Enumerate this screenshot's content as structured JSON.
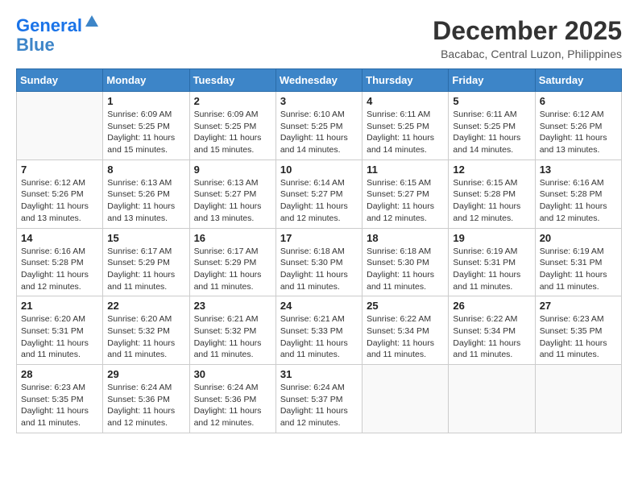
{
  "logo": {
    "line1": "General",
    "line2": "Blue"
  },
  "title": "December 2025",
  "location": "Bacabac, Central Luzon, Philippines",
  "weekdays": [
    "Sunday",
    "Monday",
    "Tuesday",
    "Wednesday",
    "Thursday",
    "Friday",
    "Saturday"
  ],
  "weeks": [
    [
      {
        "day": "",
        "sunrise": "",
        "sunset": "",
        "daylight": ""
      },
      {
        "day": "1",
        "sunrise": "Sunrise: 6:09 AM",
        "sunset": "Sunset: 5:25 PM",
        "daylight": "Daylight: 11 hours and 15 minutes."
      },
      {
        "day": "2",
        "sunrise": "Sunrise: 6:09 AM",
        "sunset": "Sunset: 5:25 PM",
        "daylight": "Daylight: 11 hours and 15 minutes."
      },
      {
        "day": "3",
        "sunrise": "Sunrise: 6:10 AM",
        "sunset": "Sunset: 5:25 PM",
        "daylight": "Daylight: 11 hours and 14 minutes."
      },
      {
        "day": "4",
        "sunrise": "Sunrise: 6:11 AM",
        "sunset": "Sunset: 5:25 PM",
        "daylight": "Daylight: 11 hours and 14 minutes."
      },
      {
        "day": "5",
        "sunrise": "Sunrise: 6:11 AM",
        "sunset": "Sunset: 5:25 PM",
        "daylight": "Daylight: 11 hours and 14 minutes."
      },
      {
        "day": "6",
        "sunrise": "Sunrise: 6:12 AM",
        "sunset": "Sunset: 5:26 PM",
        "daylight": "Daylight: 11 hours and 13 minutes."
      }
    ],
    [
      {
        "day": "7",
        "sunrise": "Sunrise: 6:12 AM",
        "sunset": "Sunset: 5:26 PM",
        "daylight": "Daylight: 11 hours and 13 minutes."
      },
      {
        "day": "8",
        "sunrise": "Sunrise: 6:13 AM",
        "sunset": "Sunset: 5:26 PM",
        "daylight": "Daylight: 11 hours and 13 minutes."
      },
      {
        "day": "9",
        "sunrise": "Sunrise: 6:13 AM",
        "sunset": "Sunset: 5:27 PM",
        "daylight": "Daylight: 11 hours and 13 minutes."
      },
      {
        "day": "10",
        "sunrise": "Sunrise: 6:14 AM",
        "sunset": "Sunset: 5:27 PM",
        "daylight": "Daylight: 11 hours and 12 minutes."
      },
      {
        "day": "11",
        "sunrise": "Sunrise: 6:15 AM",
        "sunset": "Sunset: 5:27 PM",
        "daylight": "Daylight: 11 hours and 12 minutes."
      },
      {
        "day": "12",
        "sunrise": "Sunrise: 6:15 AM",
        "sunset": "Sunset: 5:28 PM",
        "daylight": "Daylight: 11 hours and 12 minutes."
      },
      {
        "day": "13",
        "sunrise": "Sunrise: 6:16 AM",
        "sunset": "Sunset: 5:28 PM",
        "daylight": "Daylight: 11 hours and 12 minutes."
      }
    ],
    [
      {
        "day": "14",
        "sunrise": "Sunrise: 6:16 AM",
        "sunset": "Sunset: 5:28 PM",
        "daylight": "Daylight: 11 hours and 12 minutes."
      },
      {
        "day": "15",
        "sunrise": "Sunrise: 6:17 AM",
        "sunset": "Sunset: 5:29 PM",
        "daylight": "Daylight: 11 hours and 11 minutes."
      },
      {
        "day": "16",
        "sunrise": "Sunrise: 6:17 AM",
        "sunset": "Sunset: 5:29 PM",
        "daylight": "Daylight: 11 hours and 11 minutes."
      },
      {
        "day": "17",
        "sunrise": "Sunrise: 6:18 AM",
        "sunset": "Sunset: 5:30 PM",
        "daylight": "Daylight: 11 hours and 11 minutes."
      },
      {
        "day": "18",
        "sunrise": "Sunrise: 6:18 AM",
        "sunset": "Sunset: 5:30 PM",
        "daylight": "Daylight: 11 hours and 11 minutes."
      },
      {
        "day": "19",
        "sunrise": "Sunrise: 6:19 AM",
        "sunset": "Sunset: 5:31 PM",
        "daylight": "Daylight: 11 hours and 11 minutes."
      },
      {
        "day": "20",
        "sunrise": "Sunrise: 6:19 AM",
        "sunset": "Sunset: 5:31 PM",
        "daylight": "Daylight: 11 hours and 11 minutes."
      }
    ],
    [
      {
        "day": "21",
        "sunrise": "Sunrise: 6:20 AM",
        "sunset": "Sunset: 5:31 PM",
        "daylight": "Daylight: 11 hours and 11 minutes."
      },
      {
        "day": "22",
        "sunrise": "Sunrise: 6:20 AM",
        "sunset": "Sunset: 5:32 PM",
        "daylight": "Daylight: 11 hours and 11 minutes."
      },
      {
        "day": "23",
        "sunrise": "Sunrise: 6:21 AM",
        "sunset": "Sunset: 5:32 PM",
        "daylight": "Daylight: 11 hours and 11 minutes."
      },
      {
        "day": "24",
        "sunrise": "Sunrise: 6:21 AM",
        "sunset": "Sunset: 5:33 PM",
        "daylight": "Daylight: 11 hours and 11 minutes."
      },
      {
        "day": "25",
        "sunrise": "Sunrise: 6:22 AM",
        "sunset": "Sunset: 5:34 PM",
        "daylight": "Daylight: 11 hours and 11 minutes."
      },
      {
        "day": "26",
        "sunrise": "Sunrise: 6:22 AM",
        "sunset": "Sunset: 5:34 PM",
        "daylight": "Daylight: 11 hours and 11 minutes."
      },
      {
        "day": "27",
        "sunrise": "Sunrise: 6:23 AM",
        "sunset": "Sunset: 5:35 PM",
        "daylight": "Daylight: 11 hours and 11 minutes."
      }
    ],
    [
      {
        "day": "28",
        "sunrise": "Sunrise: 6:23 AM",
        "sunset": "Sunset: 5:35 PM",
        "daylight": "Daylight: 11 hours and 11 minutes."
      },
      {
        "day": "29",
        "sunrise": "Sunrise: 6:24 AM",
        "sunset": "Sunset: 5:36 PM",
        "daylight": "Daylight: 11 hours and 12 minutes."
      },
      {
        "day": "30",
        "sunrise": "Sunrise: 6:24 AM",
        "sunset": "Sunset: 5:36 PM",
        "daylight": "Daylight: 11 hours and 12 minutes."
      },
      {
        "day": "31",
        "sunrise": "Sunrise: 6:24 AM",
        "sunset": "Sunset: 5:37 PM",
        "daylight": "Daylight: 11 hours and 12 minutes."
      },
      {
        "day": "",
        "sunrise": "",
        "sunset": "",
        "daylight": ""
      },
      {
        "day": "",
        "sunrise": "",
        "sunset": "",
        "daylight": ""
      },
      {
        "day": "",
        "sunrise": "",
        "sunset": "",
        "daylight": ""
      }
    ]
  ]
}
